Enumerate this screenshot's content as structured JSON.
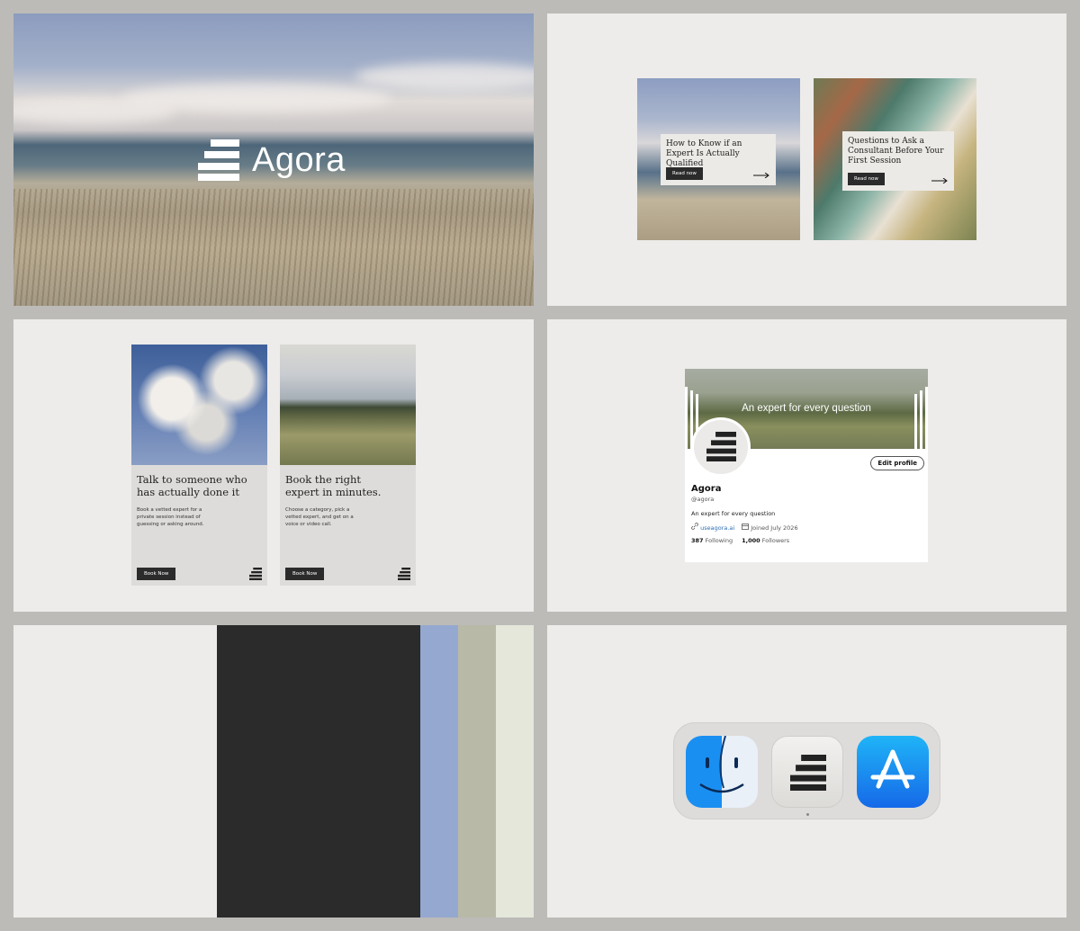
{
  "brand": {
    "name": "Agora"
  },
  "blog": {
    "cards": [
      {
        "title": "How to Know if an Expert Is Actually Qualified",
        "button": "Read now"
      },
      {
        "title": "Questions to Ask a Consultant Before Your First Session",
        "button": "Read now"
      }
    ]
  },
  "ads": [
    {
      "headline": "Talk to someone who has actually done it",
      "body": "Book a vetted expert for a private session instead of guessing or asking around.",
      "button": "Book Now"
    },
    {
      "headline": "Book the right expert in minutes.",
      "body": "Choose a category, pick a vetted expert, and get on a voice or video call.",
      "button": "Book Now"
    }
  ],
  "profile": {
    "banner_tagline": "An expert for every question",
    "edit_button": "Edit profile",
    "name": "Agora",
    "handle": "@agora",
    "bio": "An expert for every question",
    "website": "useagora.ai",
    "joined": "Joined July 2026",
    "following_count": "387",
    "following_label": "Following",
    "followers_count": "1,000",
    "followers_label": "Followers"
  },
  "palette": {
    "colors": [
      "#edecea",
      "#2b2b2b",
      "#95a8cf",
      "#b8b9a7",
      "#e4e7da"
    ]
  },
  "dock": {
    "apps": [
      "finder-icon",
      "agora-app-icon",
      "app-store-icon"
    ]
  }
}
